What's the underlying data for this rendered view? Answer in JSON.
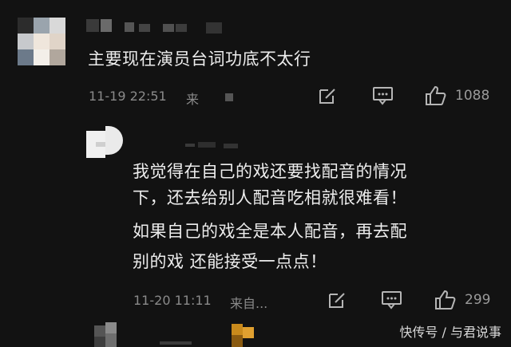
{
  "comments": [
    {
      "text": "主要现在演员台词功底不太行",
      "time": "11-19 22:51",
      "source": "来",
      "likes": "1088"
    },
    {
      "text_lines": [
        "我觉得在自己的戏还要找配音的情况",
        "下，还去给别人配音吃相就很难看！",
        "如果自己的戏全是本人配音，再去配",
        "别的戏 还能接受一点点！"
      ],
      "time": "11-20 11:11",
      "source": "来自...",
      "likes": "299"
    }
  ],
  "watermark": "快传号 / 与君说事",
  "colors": {
    "background": "#121212",
    "text": "#ededed",
    "meta": "#8a8a8a"
  },
  "icons": [
    "edit-icon",
    "comment-icon",
    "like-icon"
  ]
}
